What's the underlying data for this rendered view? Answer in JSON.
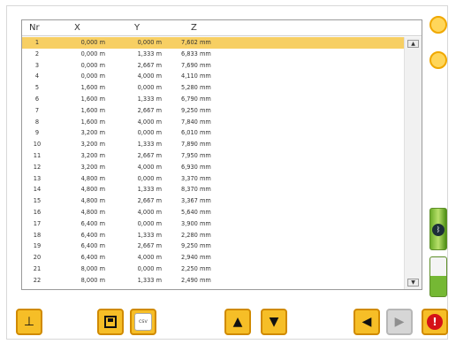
{
  "columns": [
    "Nr",
    "X",
    "Y",
    "Z"
  ],
  "rows": [
    {
      "nr": "1",
      "x": "0,000 m",
      "y": "0,000 m",
      "z": "7,602 mm"
    },
    {
      "nr": "2",
      "x": "0,000 m",
      "y": "1,333 m",
      "z": "6,833 mm"
    },
    {
      "nr": "3",
      "x": "0,000 m",
      "y": "2,667 m",
      "z": "7,690 mm"
    },
    {
      "nr": "4",
      "x": "0,000 m",
      "y": "4,000 m",
      "z": "4,110 mm"
    },
    {
      "nr": "5",
      "x": "1,600 m",
      "y": "0,000 m",
      "z": "5,280 mm"
    },
    {
      "nr": "6",
      "x": "1,600 m",
      "y": "1,333 m",
      "z": "6,790 mm"
    },
    {
      "nr": "7",
      "x": "1,600 m",
      "y": "2,667 m",
      "z": "9,250 mm"
    },
    {
      "nr": "8",
      "x": "1,600 m",
      "y": "4,000 m",
      "z": "7,840 mm"
    },
    {
      "nr": "9",
      "x": "3,200 m",
      "y": "0,000 m",
      "z": "6,010 mm"
    },
    {
      "nr": "10",
      "x": "3,200 m",
      "y": "1,333 m",
      "z": "7,890 mm"
    },
    {
      "nr": "11",
      "x": "3,200 m",
      "y": "2,667 m",
      "z": "7,950 mm"
    },
    {
      "nr": "12",
      "x": "3,200 m",
      "y": "4,000 m",
      "z": "6,930 mm"
    },
    {
      "nr": "13",
      "x": "4,800 m",
      "y": "0,000 m",
      "z": "3,370 mm"
    },
    {
      "nr": "14",
      "x": "4,800 m",
      "y": "1,333 m",
      "z": "8,370 mm"
    },
    {
      "nr": "15",
      "x": "4,800 m",
      "y": "2,667 m",
      "z": "3,367 mm"
    },
    {
      "nr": "16",
      "x": "4,800 m",
      "y": "4,000 m",
      "z": "5,640 mm"
    },
    {
      "nr": "17",
      "x": "6,400 m",
      "y": "0,000 m",
      "z": "3,900 mm"
    },
    {
      "nr": "18",
      "x": "6,400 m",
      "y": "1,333 m",
      "z": "2,280 mm"
    },
    {
      "nr": "19",
      "x": "6,400 m",
      "y": "2,667 m",
      "z": "9,250 mm"
    },
    {
      "nr": "20",
      "x": "6,400 m",
      "y": "4,000 m",
      "z": "2,940 mm"
    },
    {
      "nr": "21",
      "x": "8,000 m",
      "y": "0,000 m",
      "z": "2,250 mm"
    },
    {
      "nr": "22",
      "x": "8,000 m",
      "y": "1,333 m",
      "z": "2,490 mm"
    }
  ],
  "selected_row": "1",
  "toolbar": {
    "left_button_icon": "level-icon",
    "save_button_icon": "floppy-save-icon",
    "csv_button_label": "csv",
    "up_icon": "arrow-up-icon",
    "down_icon": "arrow-down-icon",
    "back_icon": "arrow-left-icon",
    "forward_icon": "arrow-right-icon",
    "stop_icon": "stop-icon"
  },
  "side": {
    "top_icon": "warning-icon",
    "second_icon": "plug-icon",
    "battery_icon": "battery-full-icon",
    "bluetooth_icon": "bluetooth-icon",
    "battery2_icon": "battery-half-icon"
  },
  "colors": {
    "accent": "#f6be27",
    "selected_row": "#f7cf63",
    "battery": "#6cae2a",
    "stop": "#d51217"
  }
}
